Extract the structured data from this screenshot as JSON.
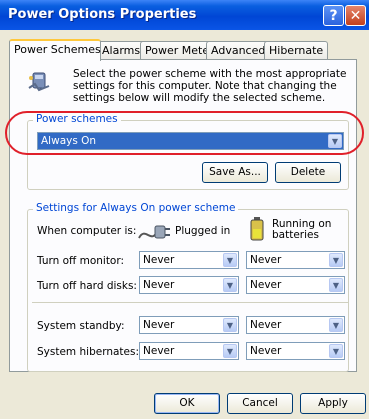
{
  "window": {
    "title": "Power Options Properties"
  },
  "title_buttons": {
    "help": "?",
    "close": "✕"
  },
  "tabs": [
    {
      "label": "Power Schemes",
      "active": true
    },
    {
      "label": "Alarms",
      "active": false
    },
    {
      "label": "Power Meter",
      "active": false
    },
    {
      "label": "Advanced",
      "active": false
    },
    {
      "label": "Hibernate",
      "active": false
    }
  ],
  "intro": {
    "text": "Select the power scheme with the most appropriate settings for this computer. Note that changing the settings below will modify the selected scheme.",
    "icon": "power-options-icon"
  },
  "power_schemes": {
    "label": "Power schemes",
    "selected": "Always On",
    "save_as_label": "Save As...",
    "delete_label": "Delete"
  },
  "settings": {
    "label": "Settings for Always On power scheme",
    "when_computer_is": "When computer is:",
    "plugged_in": "Plugged in",
    "running_on_batteries": "Running on batteries",
    "rows": [
      {
        "label": "Turn off monitor:",
        "plugged": "Never",
        "battery": "Never"
      },
      {
        "label": "Turn off hard disks:",
        "plugged": "Never",
        "battery": "Never"
      },
      {
        "label": "System standby:",
        "plugged": "Never",
        "battery": "Never"
      },
      {
        "label": "System hibernates:",
        "plugged": "Never",
        "battery": "Never"
      }
    ]
  },
  "footer": {
    "ok": "OK",
    "cancel": "Cancel",
    "apply": "Apply"
  },
  "colors": {
    "titlebar": "#0046d5",
    "group_label": "#0046d5",
    "highlight": "#316ac5",
    "annotation": "#e0202a"
  }
}
